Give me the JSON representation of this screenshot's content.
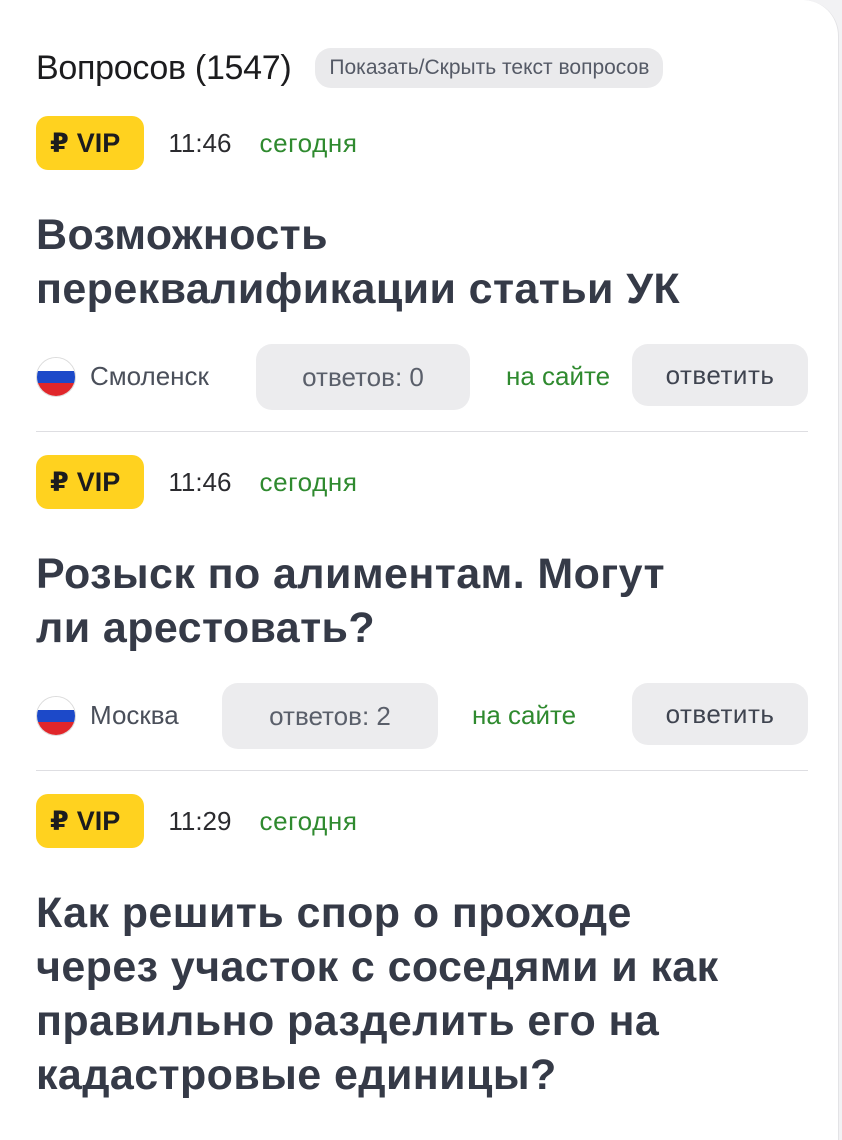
{
  "header": {
    "title": "Вопросов (1547)",
    "toggle_label": "Показать/Скрыть текст вопросов"
  },
  "colors": {
    "vip_badge": "#ffd21f",
    "green_text": "#2f8a2f",
    "button_bg": "#ececee",
    "title_text": "#353a47"
  },
  "questions": [
    {
      "badge": "VIP",
      "currency_symbol": "₽",
      "time": "11:46",
      "day": "сегодня",
      "title_lines": [
        "Возможность",
        "переквалификации статьи УК"
      ],
      "flag_icon": "russia-flag-icon",
      "city": "Смоленск",
      "answers": "ответов: 0",
      "online": "на сайте",
      "reply": "ответить"
    },
    {
      "badge": "VIP",
      "currency_symbol": "₽",
      "time": "11:46",
      "day": "сегодня",
      "title_lines": [
        "Розыск по алиментам. Могут",
        "ли арестовать?"
      ],
      "flag_icon": "russia-flag-icon",
      "city": "Москва",
      "answers": "ответов: 2",
      "online": "на сайте",
      "reply": "ответить"
    },
    {
      "badge": "VIP",
      "currency_symbol": "₽",
      "time": "11:29",
      "day": "сегодня",
      "title_lines": [
        "Как решить спор о проходе",
        "через участок с соседями и как",
        "правильно разделить его на",
        "кадастровые единицы?"
      ]
    }
  ]
}
